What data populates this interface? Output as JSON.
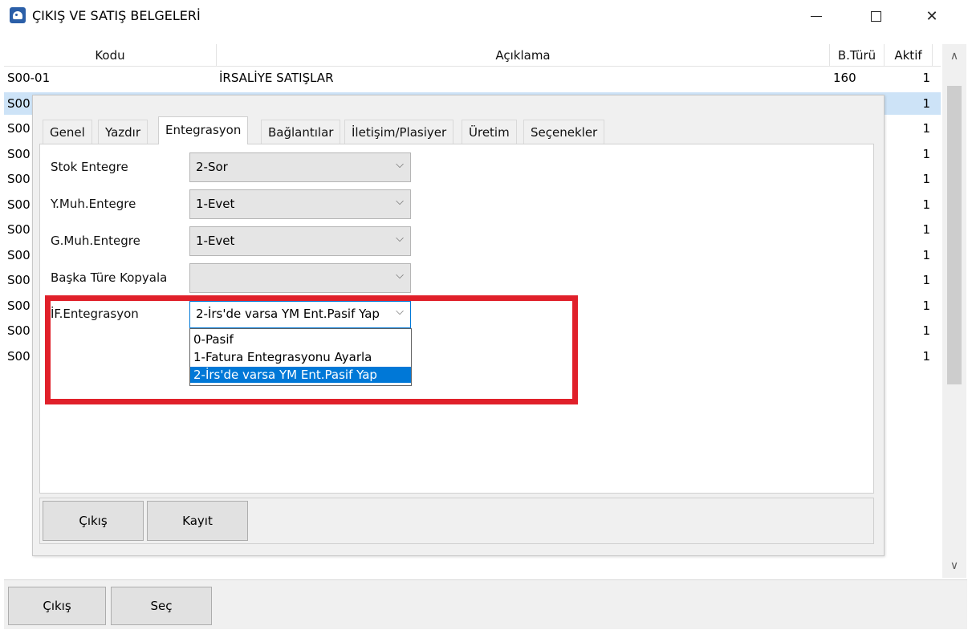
{
  "window": {
    "title": "ÇIKIŞ VE SATIŞ BELGELERİ",
    "app_icon": "app-logo-icon",
    "controls": {
      "minimize": "minimize-icon",
      "maximize": "maximize-icon",
      "close": "close-icon",
      "close_glyph": "✕"
    }
  },
  "grid": {
    "columns": [
      "Kodu",
      "Açıklama",
      "B.Türü",
      "Aktif"
    ],
    "rows": [
      {
        "kodu": "S00-01",
        "aciklama": "İRSALİYE SATIŞLAR",
        "bturu": "160",
        "aktif": "1"
      },
      {
        "kodu": "S00",
        "aciklama": "",
        "bturu": "",
        "aktif": "1"
      },
      {
        "kodu": "S00",
        "aciklama": "",
        "bturu": "",
        "aktif": "1"
      },
      {
        "kodu": "S00",
        "aciklama": "",
        "bturu": "",
        "aktif": "1"
      },
      {
        "kodu": "S00",
        "aciklama": "",
        "bturu": "",
        "aktif": "1"
      },
      {
        "kodu": "S00",
        "aciklama": "",
        "bturu": "",
        "aktif": "1"
      },
      {
        "kodu": "S00",
        "aciklama": "",
        "bturu": "",
        "aktif": "1"
      },
      {
        "kodu": "S00",
        "aciklama": "",
        "bturu": "",
        "aktif": "1"
      },
      {
        "kodu": "S00",
        "aciklama": "",
        "bturu": "",
        "aktif": "1"
      },
      {
        "kodu": "S00",
        "aciklama": "",
        "bturu": "",
        "aktif": "1"
      },
      {
        "kodu": "S00",
        "aciklama": "",
        "bturu": "",
        "aktif": "1"
      },
      {
        "kodu": "S00",
        "aciklama": "",
        "bturu": "",
        "aktif": "1"
      }
    ],
    "selected_row_index": 1
  },
  "scrollbar": {
    "up_icon": "chevron-up-icon",
    "down_icon": "chevron-down-icon",
    "up_glyph": "∧",
    "down_glyph": "∨"
  },
  "bottom_bar": {
    "exit_label": "Çıkış",
    "select_label": "Seç"
  },
  "dialog": {
    "tabs": [
      "Genel",
      "Yazdır",
      "Entegrasyon",
      "Bağlantılar",
      "İletişim/Plasiyer",
      "Üretim",
      "Seçenekler"
    ],
    "active_tab": "Entegrasyon",
    "fields": [
      {
        "label": "Stok Entegre",
        "value": "2-Sor"
      },
      {
        "label": "Y.Muh.Entegre",
        "value": "1-Evet"
      },
      {
        "label": "G.Muh.Entegre",
        "value": "1-Evet"
      },
      {
        "label": "Başka Türe Kopyala",
        "value": ""
      },
      {
        "label": "İF.Entegrasyon",
        "value": "2-İrs'de varsa YM Ent.Pasif Yap"
      }
    ],
    "dropdown_icon": "chevron-down-icon",
    "dropdown_glyph": "⌵",
    "dropdown_options": [
      "0-Pasif",
      "1-Fatura Entegrasyonu Ayarla",
      "2-İrs'de varsa YM Ent.Pasif Yap"
    ],
    "dropdown_selected_index": 2,
    "buttons": {
      "exit_label": "Çıkış",
      "save_label": "Kayıt"
    }
  },
  "colors": {
    "highlight": "#e0202a",
    "selection": "#0078d7",
    "row_selection": "#cde3f7"
  }
}
